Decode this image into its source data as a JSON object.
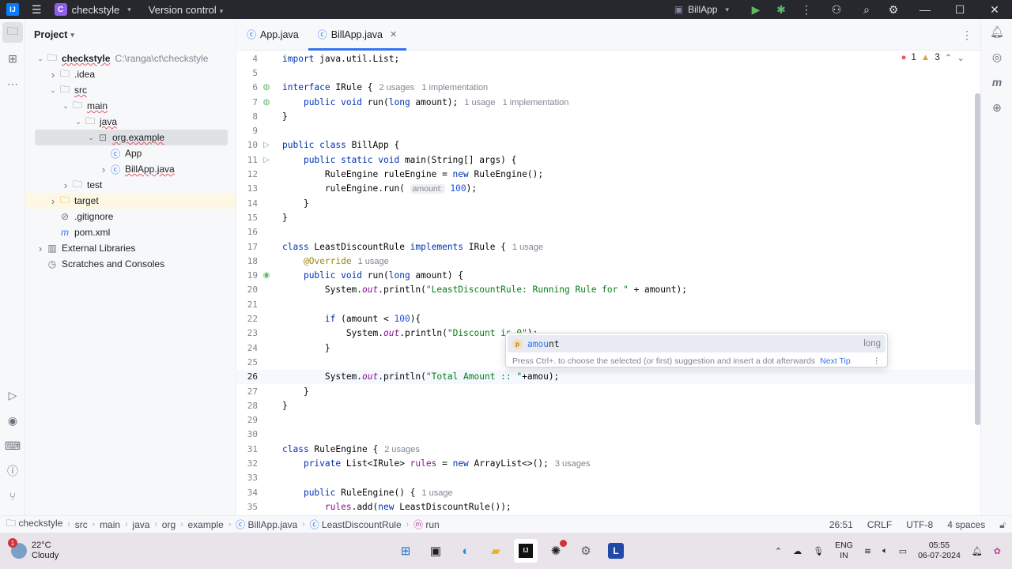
{
  "titlebar": {
    "logo_text": "IJ",
    "menu_icon": "hamburger-icon",
    "project_badge": "C",
    "project_name": "checkstyle",
    "vcs_label": "Version control",
    "run_config": "BillApp"
  },
  "project_panel": {
    "title": "Project",
    "tree": [
      {
        "label": "checkstyle",
        "path": "C:\\ranga\\ct\\checkstyle",
        "indent": 0,
        "toggle": "down",
        "icon": "module-folder-icon"
      },
      {
        "label": ".idea",
        "indent": 1,
        "toggle": "right",
        "icon": "folder-icon"
      },
      {
        "label": "src",
        "indent": 1,
        "toggle": "down",
        "icon": "folder-icon"
      },
      {
        "label": "main",
        "indent": 2,
        "toggle": "down",
        "icon": "folder-icon"
      },
      {
        "label": "java",
        "indent": 3,
        "toggle": "down",
        "icon": "source-folder-icon"
      },
      {
        "label": "org.example",
        "indent": 4,
        "toggle": "down",
        "icon": "package-icon"
      },
      {
        "label": "App",
        "indent": 5,
        "toggle": "",
        "icon": "class-icon"
      },
      {
        "label": "BillApp.java",
        "indent": 5,
        "toggle": "right",
        "icon": "class-icon"
      },
      {
        "label": "test",
        "indent": 2,
        "toggle": "right",
        "icon": "folder-icon"
      },
      {
        "label": "target",
        "indent": 1,
        "toggle": "right",
        "icon": "excluded-folder-icon"
      },
      {
        "label": ".gitignore",
        "indent": 1,
        "toggle": "",
        "icon": "ignore-file-icon"
      },
      {
        "label": "pom.xml",
        "indent": 1,
        "toggle": "",
        "icon": "maven-icon"
      },
      {
        "label": "External Libraries",
        "indent": 0,
        "toggle": "right",
        "icon": "library-icon"
      },
      {
        "label": "Scratches and Consoles",
        "indent": 0,
        "toggle": "",
        "icon": "scratches-icon"
      }
    ]
  },
  "tabs": [
    {
      "label": "App.java",
      "active": false
    },
    {
      "label": "BillApp.java",
      "active": true
    }
  ],
  "inspections": {
    "errors": "1",
    "warnings": "3"
  },
  "code_lines": [
    {
      "n": "4",
      "html": "<span class=\"kw\">import</span> java.util.List;"
    },
    {
      "n": "5",
      "html": ""
    },
    {
      "n": "6",
      "html": "<span class=\"kw\">interface</span> IRule {<span class=\"hint\">2 usages &nbsp; 1 implementation</span>",
      "gutter": "impl"
    },
    {
      "n": "7",
      "html": "    <span class=\"kw\">public void</span> run(<span class=\"kw\">long</span> amount);<span class=\"hint\">1 usage &nbsp; 1 implementation</span>",
      "gutter": "impl"
    },
    {
      "n": "8",
      "html": "}"
    },
    {
      "n": "9",
      "html": ""
    },
    {
      "n": "10",
      "html": "<span class=\"kw\">public class</span> BillApp {",
      "gutter": "run"
    },
    {
      "n": "11",
      "html": "    <span class=\"kw\">public static void</span> main(String[] args) {",
      "gutter": "run"
    },
    {
      "n": "12",
      "html": "        RuleEngine ruleEngine = <span class=\"kw\">new</span> RuleEngine();"
    },
    {
      "n": "13",
      "html": "        ruleEngine.run( <span class=\"inlay\">amount:</span> <span class=\"num\">100</span>);"
    },
    {
      "n": "14",
      "html": "    }"
    },
    {
      "n": "15",
      "html": "}"
    },
    {
      "n": "16",
      "html": ""
    },
    {
      "n": "17",
      "html": "<span class=\"kw\">class</span> LeastDiscountRule <span class=\"kw\">implements</span> IRule {<span class=\"hint\">1 usage</span>"
    },
    {
      "n": "18",
      "html": "    <span class=\"ann\">@Override</span><span class=\"hint\">1 usage</span>"
    },
    {
      "n": "19",
      "html": "    <span class=\"kw\">public void</span> run(<span class=\"kw\">long</span> amount) {",
      "gutter": "override"
    },
    {
      "n": "20",
      "html": "        System.<span class=\"ital\">out</span>.println(<span class=\"str\">\"LeastDiscountRule: Running Rule for \"</span> + amount);"
    },
    {
      "n": "21",
      "html": ""
    },
    {
      "n": "22",
      "html": "        <span class=\"kw\">if</span> (amount &lt; <span class=\"num\">100</span>){"
    },
    {
      "n": "23",
      "html": "            System.<span class=\"ital\">out</span>.println(<span class=\"str\">\"Discount is 0\"</span>);"
    },
    {
      "n": "24",
      "html": "        }"
    },
    {
      "n": "25",
      "html": ""
    },
    {
      "n": "26",
      "html": "        System.<span class=\"ital\">out</span>.println(<span class=\"str\">\"Total Amount :: \"</span>+amou);",
      "current": true
    },
    {
      "n": "27",
      "html": "    }"
    },
    {
      "n": "28",
      "html": "}"
    },
    {
      "n": "29",
      "html": ""
    },
    {
      "n": "30",
      "html": ""
    },
    {
      "n": "31",
      "html": "<span class=\"kw\">class</span> RuleEngine {<span class=\"hint\">2 usages</span>"
    },
    {
      "n": "32",
      "html": "    <span class=\"kw\">private</span> List&lt;IRule&gt; <span class=\"fld\">rules</span> = <span class=\"kw\">new</span> ArrayList&lt;&gt;();<span class=\"hint\">3 usages</span>"
    },
    {
      "n": "33",
      "html": ""
    },
    {
      "n": "34",
      "html": "    <span class=\"kw\">public</span> RuleEngine() {<span class=\"hint\">1 usage</span>"
    },
    {
      "n": "35",
      "html": "        <span class=\"fld\">rules</span>.add(<span class=\"kw\">new</span> LeastDiscountRule());"
    }
  ],
  "completion": {
    "item_prefix": "amou",
    "item_rest": "nt",
    "item_type": "long",
    "footer": "Press Ctrl+. to choose the selected (or first) suggestion and insert a dot afterwards",
    "next_tip": "Next Tip"
  },
  "statusbar": {
    "breadcrumb": [
      "checkstyle",
      "src",
      "main",
      "java",
      "org",
      "example",
      "BillApp.java",
      "LeastDiscountRule",
      "run"
    ],
    "position": "26:51",
    "line_sep": "CRLF",
    "encoding": "UTF-8",
    "indent": "4 spaces"
  },
  "taskbar": {
    "temp": "22°C",
    "weather": "Cloudy",
    "weather_badge": "1",
    "lang1": "ENG",
    "lang2": "IN",
    "time": "05:55",
    "date": "06-07-2024"
  },
  "colors": {
    "accent": "#3574f0",
    "titlebar_bg": "#27282e",
    "keyword": "#0033b3",
    "string": "#067d17"
  }
}
